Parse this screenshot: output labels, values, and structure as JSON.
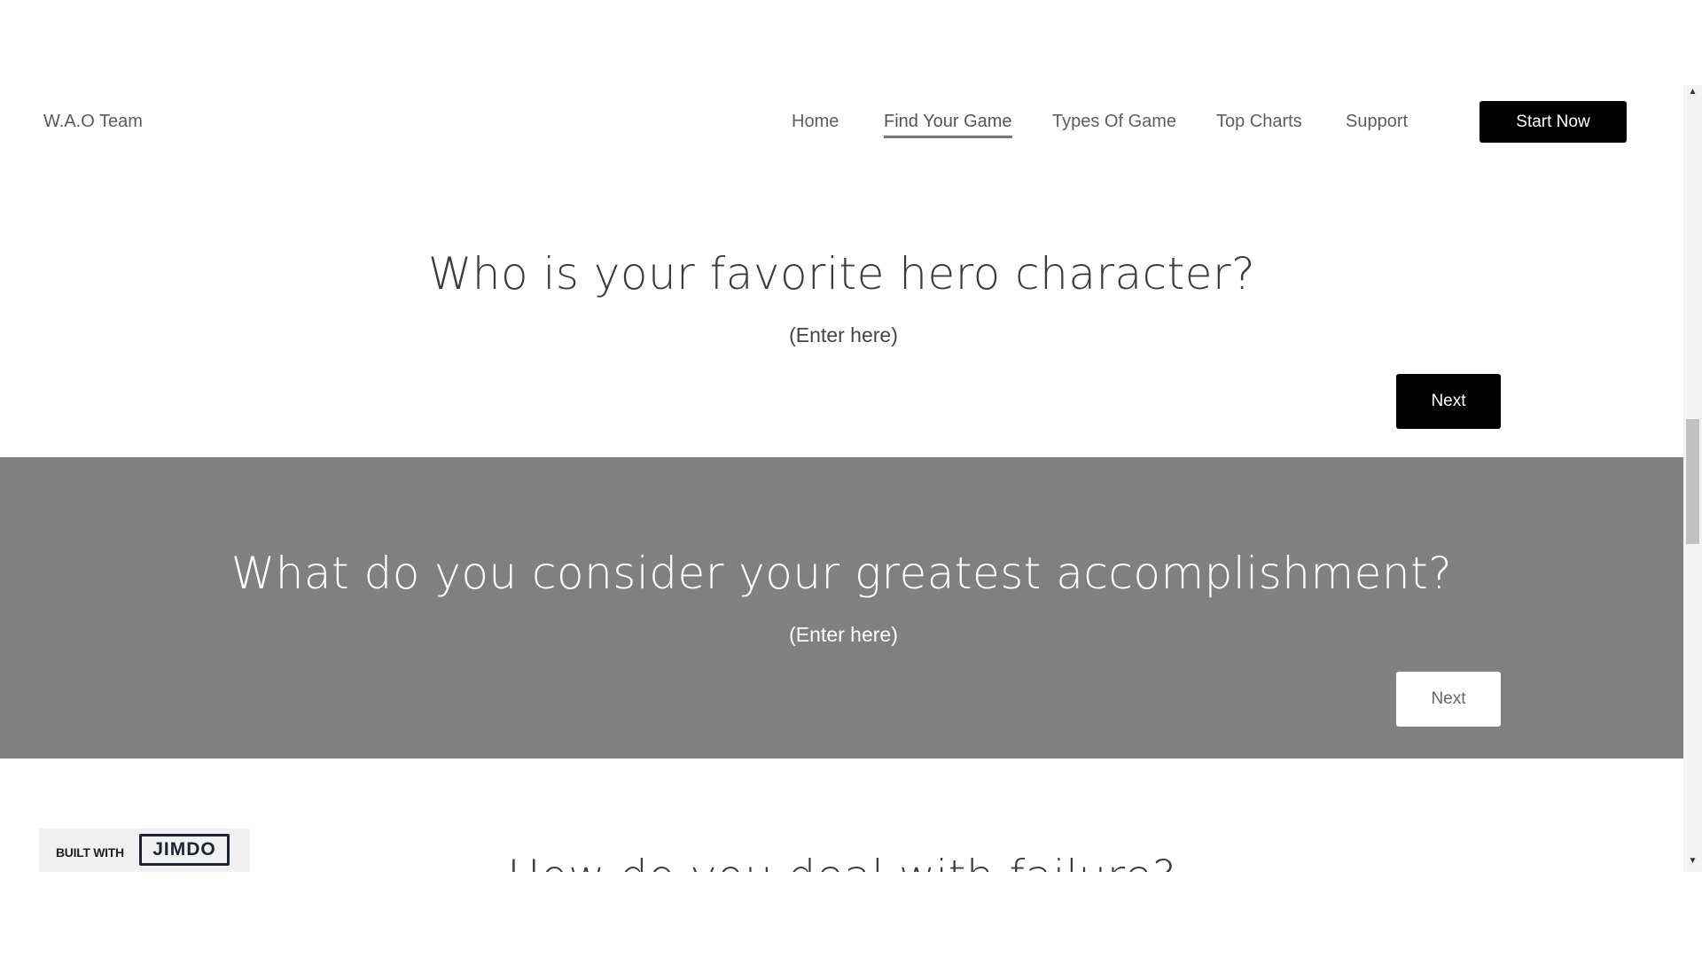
{
  "brand": {
    "name": "W.A.O Team"
  },
  "nav": {
    "items": [
      {
        "label": "Home"
      },
      {
        "label": "Find Your Game"
      },
      {
        "label": "Types Of Game"
      },
      {
        "label": "Top Charts"
      },
      {
        "label": "Support"
      }
    ],
    "active": "Find Your Game",
    "cta_label": "Start Now"
  },
  "sections": [
    {
      "question": "Who is your favorite hero character?",
      "placeholder": "(Enter here)",
      "next_label": "Next"
    },
    {
      "question": "What do you consider your greatest accomplishment?",
      "placeholder": "(Enter here)",
      "next_label": "Next"
    },
    {
      "question": "How do you deal with failure?"
    }
  ],
  "badge": {
    "built_with": "BUILT WITH",
    "logo_text": "JIMDO"
  },
  "colors": {
    "accent_dark": "#000000",
    "band_gray": "#808080",
    "text": "#555555"
  }
}
